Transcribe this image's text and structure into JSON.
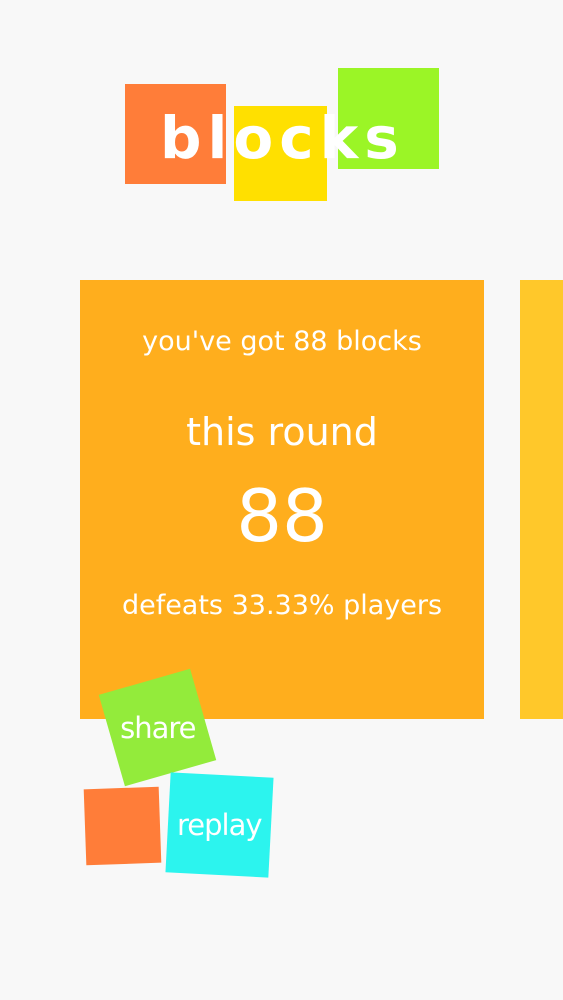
{
  "logo": {
    "text": "blocks",
    "block_colors": [
      "#ff7d39",
      "#ffe000",
      "#9bf526"
    ]
  },
  "result": {
    "got_text": "you've got 88 blocks",
    "round_label": "this round",
    "score": "88",
    "defeats_text": "defeats 33.33% players"
  },
  "buttons": {
    "share_label": "share",
    "replay_label": "replay"
  },
  "colors": {
    "background": "#f8f8f8",
    "card": "#ffae1d",
    "next_card": "#ffc82a",
    "share": "#93eb3b",
    "replay": "#2cf4ee",
    "decor": "#ff7d39"
  }
}
